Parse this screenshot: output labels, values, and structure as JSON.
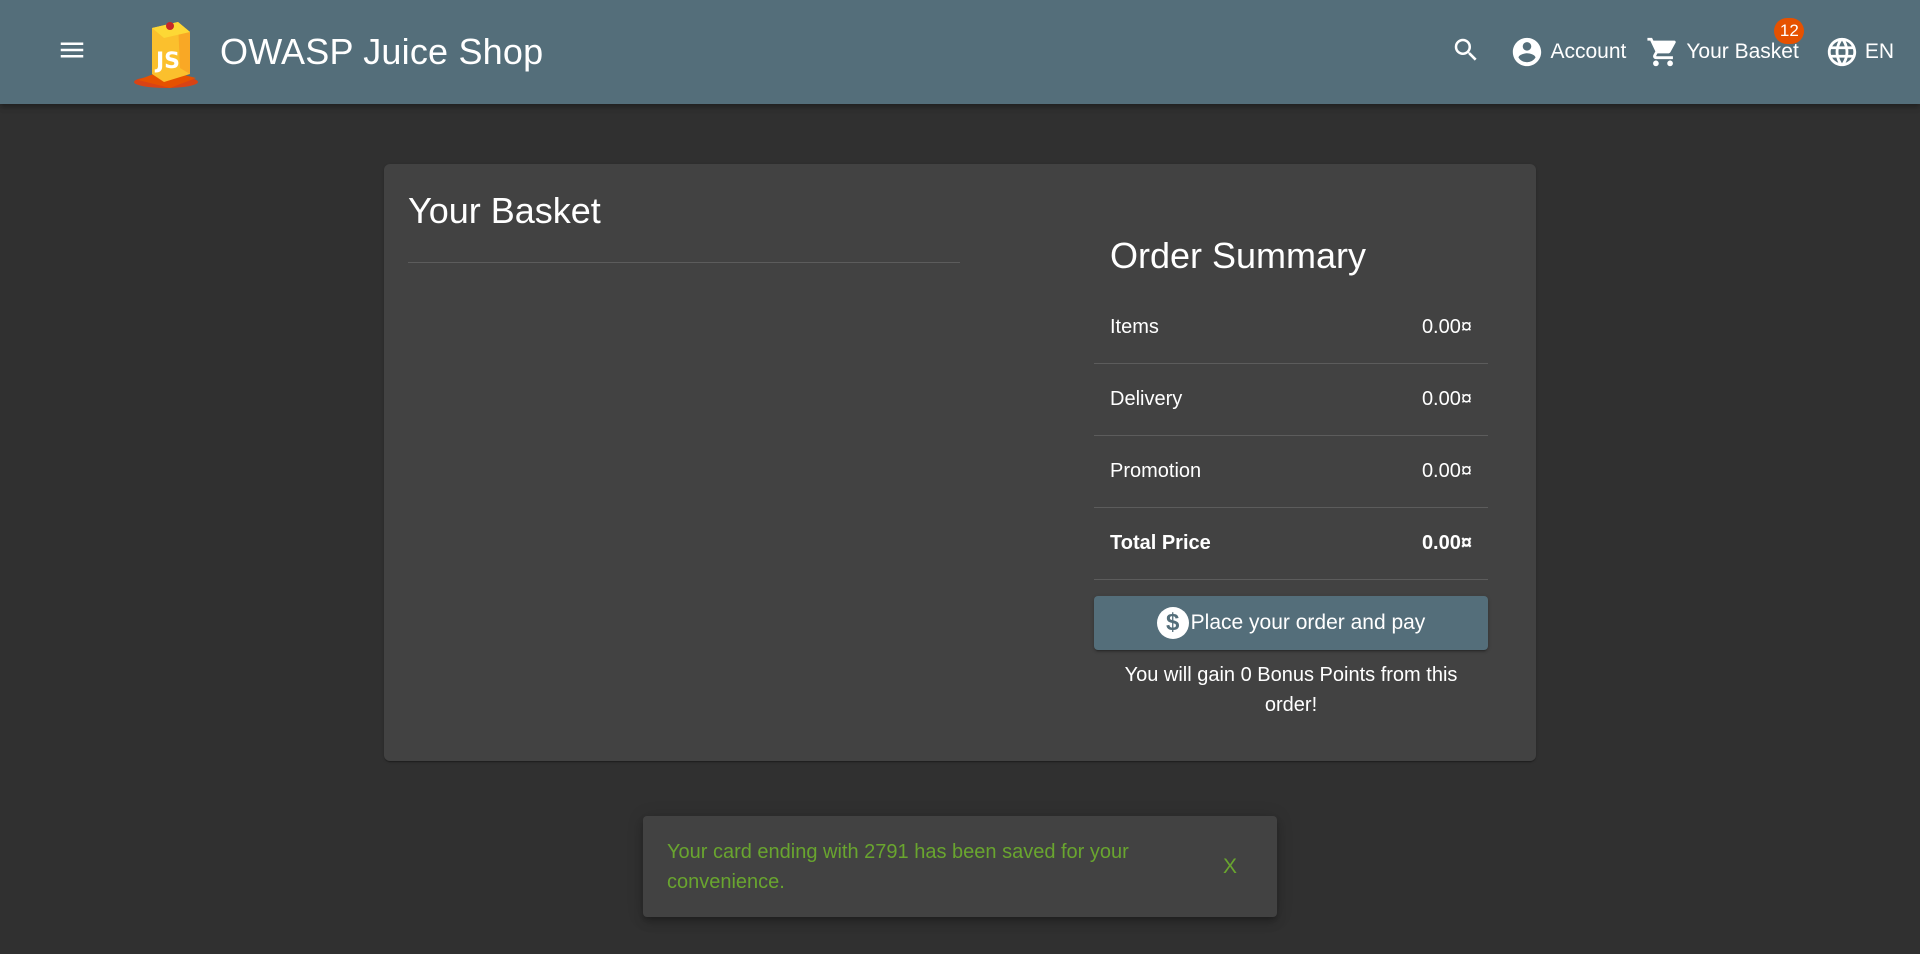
{
  "header": {
    "menu_icon": "menu-icon",
    "app_title": "OWASP Juice Shop",
    "logo_text": "JS",
    "search_icon": "search-icon",
    "account_label": "Account",
    "basket_label": "Your Basket",
    "basket_count": "12",
    "language_label": "EN",
    "colors": {
      "toolbar": "#546e7a",
      "badge": "#e65100"
    }
  },
  "basket": {
    "title": "Your Basket"
  },
  "summary": {
    "title": "Order Summary",
    "rows": [
      {
        "label": "Items",
        "value": "0.00¤"
      },
      {
        "label": "Delivery",
        "value": "0.00¤"
      },
      {
        "label": "Promotion",
        "value": "0.00¤"
      }
    ],
    "total": {
      "label": "Total Price",
      "value": "0.00¤"
    },
    "pay_button_label": "Place your order and pay",
    "pay_icon_glyph": "$",
    "bonus_text": "You will gain 0 Bonus Points from this order!"
  },
  "snackbar": {
    "message": "Your card ending with 2791 has been saved for your convenience.",
    "close_label": "X",
    "color": "#69a52f"
  }
}
